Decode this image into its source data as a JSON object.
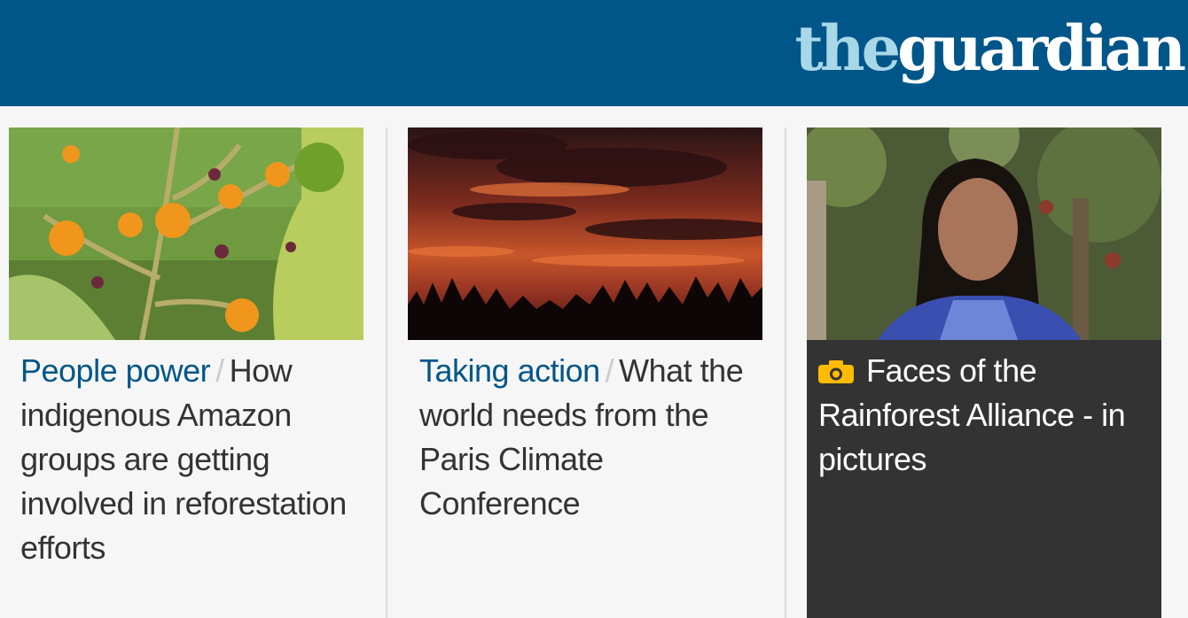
{
  "brand": {
    "logo_the": "the",
    "logo_guardian": "guardian",
    "color": "#005689"
  },
  "cards": [
    {
      "kicker": "People power",
      "separator": "/",
      "headline": "How indigenous Amazon groups are getting involved in reforestation efforts",
      "image": "orange-berries-plant-photo"
    },
    {
      "kicker": "Taking action",
      "separator": "/",
      "headline": "What the world needs from the Paris Climate Conference",
      "image": "red-sunset-over-treeline-photo"
    },
    {
      "icon": "camera-icon",
      "headline": "Faces of the Rainforest Alliance - in pictures",
      "image": "indigenous-woman-portrait-photo"
    }
  ]
}
